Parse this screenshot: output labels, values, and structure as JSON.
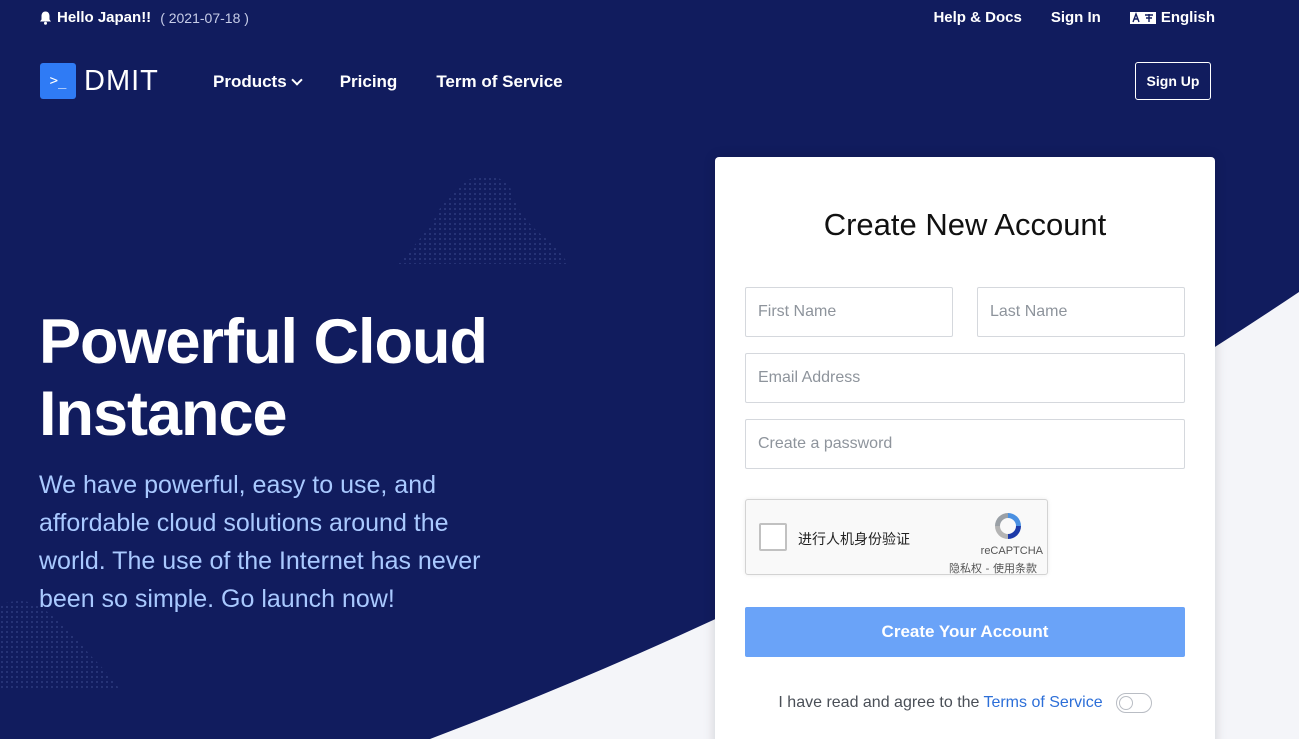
{
  "topbar": {
    "announcement": "Hello Japan!!",
    "announcement_date": "( 2021-07-18 )",
    "help_docs": "Help & Docs",
    "sign_in": "Sign In",
    "language": "English"
  },
  "nav": {
    "logo_text": "DMIT",
    "logo_glyph": ">_",
    "products": "Products",
    "pricing": "Pricing",
    "terms": "Term of Service",
    "sign_up": "Sign Up"
  },
  "hero": {
    "title_line1": "Powerful Cloud",
    "title_line2": "Instance",
    "subtitle": "We have powerful, easy to use, and affordable cloud solutions around the world. The use of the Internet has never been so simple. Go launch now!"
  },
  "form": {
    "title": "Create New Account",
    "first_name_placeholder": "First Name",
    "last_name_placeholder": "Last Name",
    "email_placeholder": "Email Address",
    "password_placeholder": "Create a password",
    "recaptcha_label": "进行人机身份验证",
    "recaptcha_brand": "reCAPTCHA",
    "recaptcha_links": "隐私权 - 使用条款",
    "submit": "Create Your Account",
    "agree_text": "I have read and agree to the",
    "agree_link": "Terms of Service",
    "agree_toggle_on": false
  },
  "colors": {
    "background": "#111c5e",
    "accent": "#6aa3f8",
    "logo": "#2f7bf5",
    "subtitle": "#a9c9ff"
  }
}
